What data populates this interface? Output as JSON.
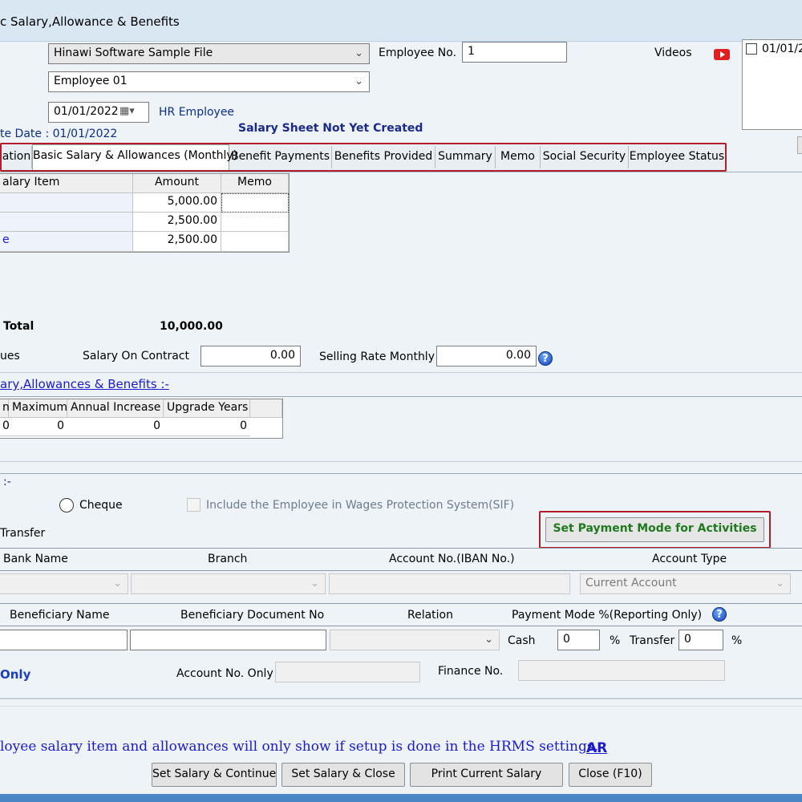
{
  "window": {
    "title": "c Salary,Allowance & Benefits"
  },
  "header": {
    "company_value": "Hinawi Software Sample File",
    "employee_value": "Employee 01",
    "date_value": "01/01/2022",
    "hr_employee_label": "HR Employee",
    "rate_date_label": "te Date : 01/01/2022",
    "salary_sheet_status": "Salary Sheet Not Yet Created",
    "employee_no_label": "Employee No.",
    "employee_no_value": "1",
    "videos_label": "Videos",
    "side_checkbox_label": "01/01/2"
  },
  "tabs": [
    {
      "label": "ation"
    },
    {
      "label": "Basic Salary & Allowances (Monthly)"
    },
    {
      "label": "Benefit Payments"
    },
    {
      "label": "Benefits Provided"
    },
    {
      "label": "Summary"
    },
    {
      "label": "Memo"
    },
    {
      "label": "Social Security"
    },
    {
      "label": "Employee Status"
    }
  ],
  "salary_grid": {
    "headers": [
      "alary Item",
      "Amount",
      "Memo"
    ],
    "rows": [
      {
        "item": "",
        "amount": "5,000.00",
        "memo": ""
      },
      {
        "item": "",
        "amount": "2,500.00",
        "memo": ""
      },
      {
        "item": "e",
        "amount": "2,500.00",
        "memo": ""
      }
    ]
  },
  "totals": {
    "total_label": "Total",
    "total_value": "10,000.00",
    "values_label": "ues",
    "salary_on_contract_label": "Salary On Contract",
    "salary_on_contract_value": "0.00",
    "selling_rate_label": "Selling Rate Monthly",
    "selling_rate_value": "0.00"
  },
  "increment": {
    "link_label": "ary,Allowances & Benefits :-",
    "headers": [
      "n",
      "Maximum",
      "Annual Increase",
      "Upgrade Years"
    ],
    "values": [
      "0",
      "0",
      "0",
      "0"
    ]
  },
  "payment": {
    "section_label": ":-",
    "cheque_label": "Cheque",
    "sif_label": "Include the Employee in Wages Protection System(SIF)",
    "transfer_label": "Transfer",
    "set_payment_mode_button": "Set Payment Mode for Activities",
    "bank_headers": {
      "bank_name": "Bank Name",
      "branch": "Branch",
      "account_no": "Account No.(IBAN No.)",
      "account_type": "Account Type"
    },
    "account_type_value": "Current Account",
    "beneficiary_headers": {
      "name": "Beneficiary Name",
      "document_no": "Beneficiary Document No",
      "relation": "Relation",
      "payment_mode": "Payment Mode %(Reporting Only)"
    },
    "cash_label": "Cash",
    "cash_value": "0",
    "percent_sign": "%",
    "transfer_pct_label": "Transfer",
    "transfer_pct_value": "0",
    "only_label": "Only",
    "account_no_only_label": "Account No. Only",
    "finance_no_label": "Finance No."
  },
  "footer": {
    "note": "loyee salary item and allowances will only show if setup is done in the HRMS settings.",
    "ar_link": "AR",
    "buttons": {
      "set_continue": "Set Salary & Continue",
      "set_close": "Set Salary & Close",
      "print": "Print Current Salary",
      "close": "Close  (F10)"
    }
  },
  "icons": {
    "video": "youtube-icon",
    "help": "help-icon",
    "calendar": "calendar-icon"
  },
  "colors": {
    "highlight_border": "#b21d2a",
    "status_text": "#1a2a8c",
    "link": "#1a1ad0",
    "button_green": "#1f7a1f"
  }
}
